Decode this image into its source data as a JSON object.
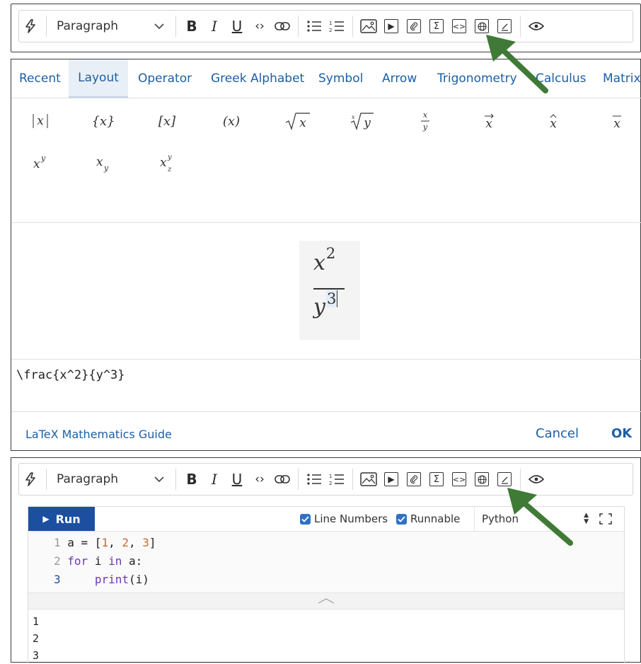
{
  "toolbar": {
    "paragraph_label": "Paragraph",
    "bold": "B",
    "italic": "I",
    "underline": "U",
    "code_inline": "‹›",
    "sigma": "Σ",
    "codeblock": "<>"
  },
  "math_dialog": {
    "tabs": [
      {
        "label": "Recent"
      },
      {
        "label": "Layout"
      },
      {
        "label": "Operator"
      },
      {
        "label": "Greek Alphabet"
      },
      {
        "label": "Symbol"
      },
      {
        "label": "Arrow"
      },
      {
        "label": "Trigonometry"
      },
      {
        "label": "Calculus"
      },
      {
        "label": "Matrix"
      }
    ],
    "active_tab": "Layout",
    "preview": {
      "numerator_base": "x",
      "numerator_exp": "2",
      "denominator_base": "y",
      "denominator_exp": "3"
    },
    "latex_input": "\\frac{x^2}{y^3}",
    "guide_link": "LaTeX Mathematics Guide",
    "cancel_label": "Cancel",
    "ok_label": "OK"
  },
  "code_block": {
    "run_label": "Run",
    "line_numbers_label": "Line Numbers",
    "line_numbers_checked": true,
    "runnable_label": "Runnable",
    "runnable_checked": true,
    "language": "Python",
    "lines": [
      {
        "num": "1",
        "text": "a = [1, 2, 3]"
      },
      {
        "num": "2",
        "text": "for i in a:"
      },
      {
        "num": "3",
        "text": "    print(i)"
      }
    ],
    "output": [
      "1",
      "2",
      "3"
    ]
  },
  "colors": {
    "accent": "#1c5fa5",
    "run_bg": "#1c4fa0",
    "arrow": "#3f7a36",
    "checkbox": "#2f72c4"
  }
}
